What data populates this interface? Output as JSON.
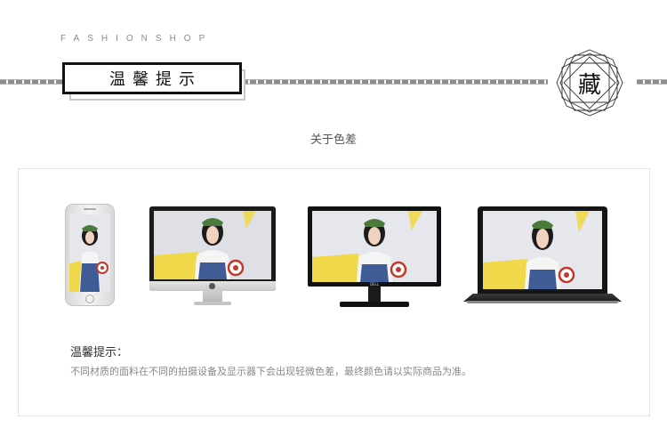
{
  "header": {
    "brand": "FASHIONSHOP",
    "title": "温馨提示",
    "badge_char": "藏"
  },
  "subtitle": "关于色差",
  "devices": [
    {
      "name": "phone",
      "brand_mark": ""
    },
    {
      "name": "imac",
      "brand_mark": ""
    },
    {
      "name": "monitor",
      "brand_mark": "DELL"
    },
    {
      "name": "laptop",
      "brand_mark": ""
    }
  ],
  "notice": {
    "title": "温馨提示：",
    "body": "不同材质的面料在不同的拍摄设备及显示器下会出现轻微色差，最终颜色请以实际商品为准。"
  },
  "colors": {
    "frame_black": "#111111",
    "chain_gray": "#8c8c8c",
    "panel_border": "#e3e3e3",
    "muted_text": "#888888"
  }
}
